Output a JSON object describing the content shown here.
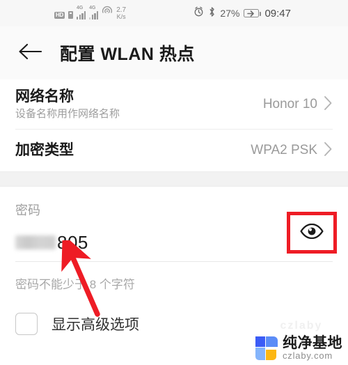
{
  "status_bar": {
    "hd_badge": "HD",
    "sim_icon": "sim-card-icon",
    "network1_label": "4G",
    "network2_label": "4G",
    "hotspot_icon": "hotspot-icon",
    "net_speed_value": "2.7",
    "net_speed_unit": "K/s",
    "alarm_icon": "alarm-clock-icon",
    "bluetooth_icon": "bluetooth-icon",
    "battery_percent": "27%",
    "battery_icon": "battery-charging-icon",
    "clock": "09:47"
  },
  "app_bar": {
    "back_icon": "back-arrow-icon",
    "title": "配置 WLAN 热点"
  },
  "rows": [
    {
      "title": "网络名称",
      "subtitle": "设备名称用作网络名称",
      "value": "Honor 10",
      "chevron_icon": "chevron-right-icon"
    },
    {
      "title": "加密类型",
      "subtitle": "",
      "value": "WPA2 PSK",
      "chevron_icon": "chevron-right-icon"
    }
  ],
  "password": {
    "label": "密码",
    "masked_prefix": "••••••••",
    "visible_suffix": "805",
    "hint": "密码不能少于 8 个字符",
    "toggle_icon": "eye-visibility-icon",
    "highlight_color": "#ee1c25"
  },
  "advanced": {
    "checkbox_icon": "checkbox-unchecked-icon",
    "label": "显示高级选项",
    "checked": false
  },
  "annotation": {
    "arrow_icon": "red-arrow-annotation",
    "color": "#ee1c25"
  },
  "watermark": {
    "logo_icon": "czlaby-logo-icon",
    "brand_cn": "纯净基地",
    "brand_url": "czlaby.com",
    "ghost_text": "czlaby"
  }
}
